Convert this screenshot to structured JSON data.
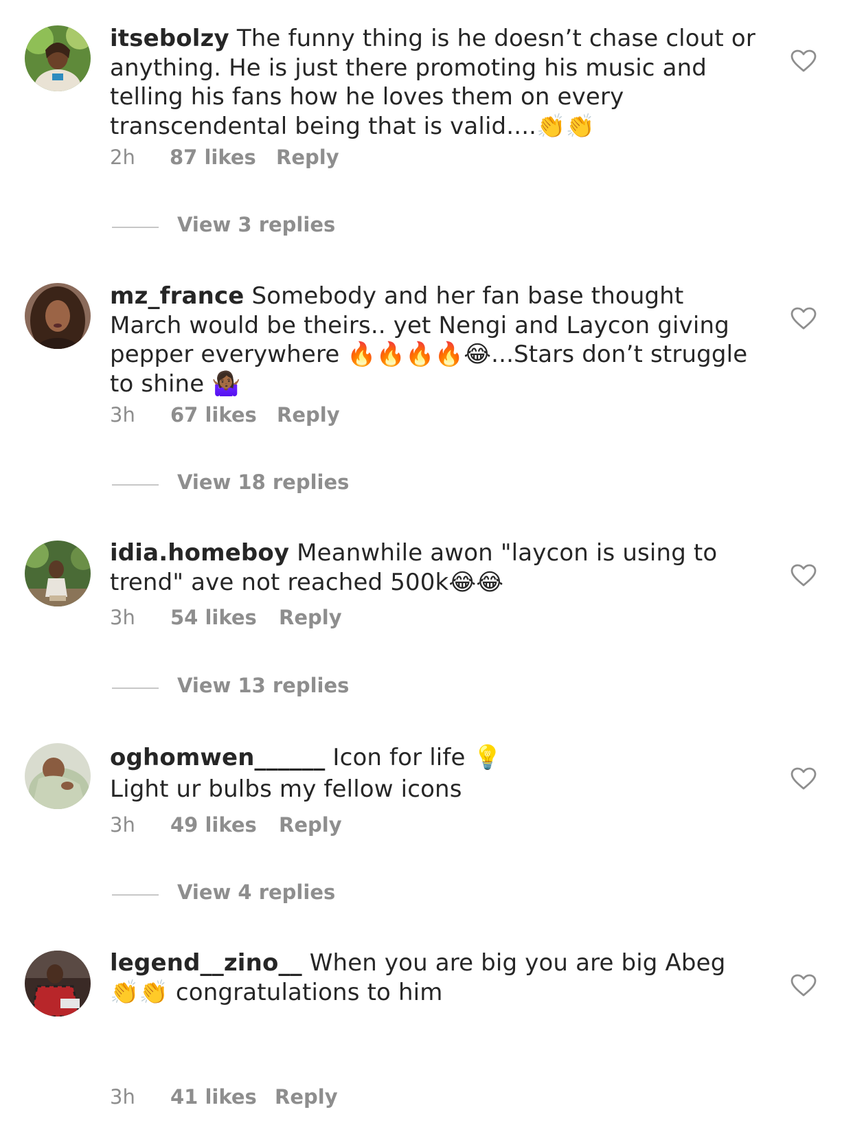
{
  "colors": {
    "text": "#262626",
    "secondary": "#8e8e8e",
    "divider": "#c7c7c7"
  },
  "comments": [
    {
      "username": "itsebolzy",
      "text": " The funny thing is he doesn’t chase clout or anything. He is just there promoting his music and telling his fans how he loves them on every transcendental being that is valid....👏👏",
      "time": "2h",
      "likes": "87 likes",
      "reply": "Reply",
      "view_replies": "View 3 replies",
      "avatar_icon": "avatar-photo"
    },
    {
      "username": "mz_france",
      "text": " Somebody and her fan base thought March would be theirs.. yet Nengi and Laycon giving pepper everywhere 🔥🔥🔥🔥😂...Stars don’t struggle to shine 🤷🏾‍♀️",
      "time": "3h",
      "likes": "67 likes",
      "reply": "Reply",
      "view_replies": "View 18 replies",
      "avatar_icon": "avatar-photo"
    },
    {
      "username": "idia.homeboy",
      "text": " Meanwhile awon \"laycon is using to trend\" ave not reached 500k😂😂",
      "time": "3h",
      "likes": "54 likes",
      "reply": "Reply",
      "view_replies": "View 13 replies",
      "avatar_icon": "avatar-photo"
    },
    {
      "username": "oghomwen______",
      "text": " Icon for life 💡\nLight ur bulbs my fellow icons",
      "time": "3h",
      "likes": "49 likes",
      "reply": "Reply",
      "view_replies": "View 4 replies",
      "avatar_icon": "avatar-photo"
    },
    {
      "username": "legend__zino__",
      "text": " When you are big you are big Abeg 👏👏 congratulations to him",
      "time": "3h",
      "likes": "41 likes",
      "reply": "Reply",
      "avatar_icon": "avatar-photo"
    }
  ],
  "like_icon": "heart-outline-icon"
}
